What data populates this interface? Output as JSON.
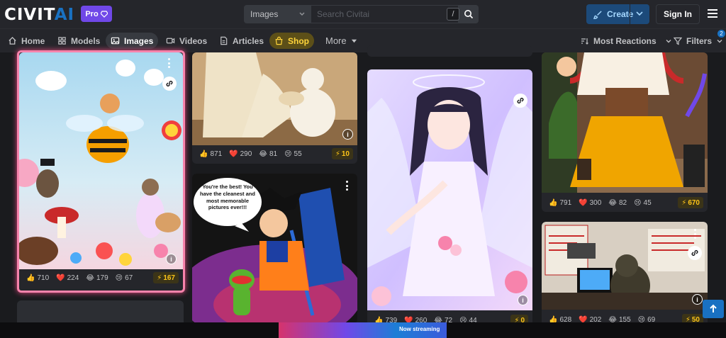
{
  "header": {
    "logo_main": "CIVIT",
    "logo_accent": "AI",
    "pro_label": "Pro",
    "search_scope": "Images",
    "search_placeholder": "Search Civitai",
    "search_shortcut": "/",
    "create_label": "Create",
    "signin_label": "Sign In"
  },
  "nav": {
    "items": [
      {
        "label": "Home",
        "icon": "home-icon"
      },
      {
        "label": "Models",
        "icon": "grid-icon"
      },
      {
        "label": "Images",
        "icon": "photo-icon"
      },
      {
        "label": "Videos",
        "icon": "video-icon"
      },
      {
        "label": "Articles",
        "icon": "article-icon"
      },
      {
        "label": "Shop",
        "icon": "shopping-bag-icon"
      },
      {
        "label": "More",
        "icon": "caret-down-icon"
      }
    ],
    "sort_label": "Most Reactions",
    "filters_label": "Filters",
    "filters_count": "2"
  },
  "cards": [
    {
      "likes": "710",
      "hearts": "224",
      "laughs": "179",
      "cries": "67",
      "buzz": "167"
    },
    {
      "likes": "871",
      "hearts": "290",
      "laughs": "81",
      "cries": "55",
      "buzz": "10"
    },
    {
      "speech": "You're the best! You have the cleanest and most memorable pictures ever!!!"
    },
    {
      "likes": "739",
      "hearts": "260",
      "laughs": "72",
      "cries": "44",
      "buzz": "0"
    },
    {
      "likes": "791",
      "hearts": "300",
      "laughs": "82",
      "cries": "45",
      "buzz": "670"
    },
    {
      "likes": "628",
      "hearts": "202",
      "laughs": "155",
      "cries": "69",
      "buzz": "50"
    }
  ],
  "ad": {
    "text": "Now streaming"
  },
  "colors": {
    "accent": "#1971c2",
    "pro": "#7048e8",
    "buzz": "#fcc419",
    "highlight_border": "#f783ac"
  }
}
